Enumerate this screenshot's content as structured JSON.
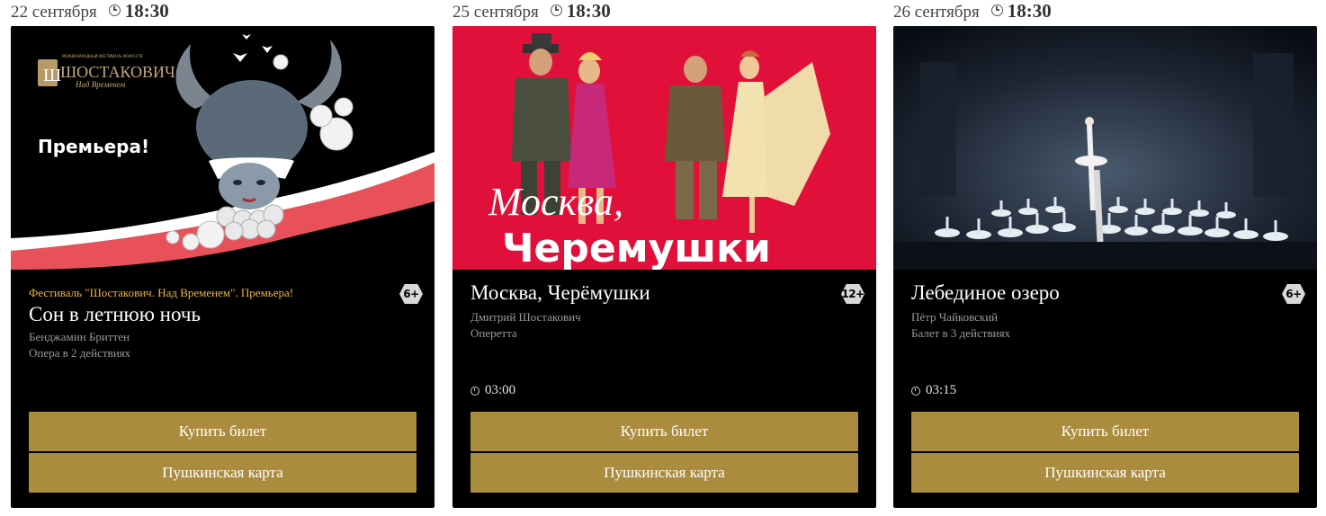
{
  "events": [
    {
      "date": "22 сентября",
      "time": "18:30",
      "poster": {
        "brand": "ШОСТАКОВИЧ",
        "brand_subtitle": "Над Временем",
        "brand_tag": "МЕЖДУНАРОДНЫЙ ФЕСТИВАЛЬ ИСКУССТВ",
        "caption": "Премьера!"
      },
      "tagline": "Фестиваль \"Шостакович. Над Временем\". Премьера!",
      "title": "Сон в летнюю ночь",
      "composer": "Бенджамин Бриттен",
      "genre": "Опера в 2 действиях",
      "duration": "",
      "age": "6+",
      "buy_label": "Купить билет",
      "pushkin_label": "Пушкинская карта"
    },
    {
      "date": "25 сентября",
      "time": "18:30",
      "poster": {
        "line1": "Москва,",
        "line2": "Черемушки"
      },
      "tagline": "",
      "title": "Москва, Черёмушки",
      "composer": "Дмитрий Шостакович",
      "genre": "Оперетта",
      "duration": "03:00",
      "age": "12+",
      "buy_label": "Купить билет",
      "pushkin_label": "Пушкинская карта"
    },
    {
      "date": "26 сентября",
      "time": "18:30",
      "poster": {},
      "tagline": "",
      "title": "Лебединое озеро",
      "composer": "Пётр Чайковский",
      "genre": "Балет в 3 действиях",
      "duration": "03:15",
      "age": "6+",
      "buy_label": "Купить билет",
      "pushkin_label": "Пушкинская карта"
    }
  ],
  "colors": {
    "card_bg": "#000000",
    "button_bg": "#ab8c3e",
    "tagline": "#f0b43c",
    "poster2_bg": "#e0103a"
  }
}
